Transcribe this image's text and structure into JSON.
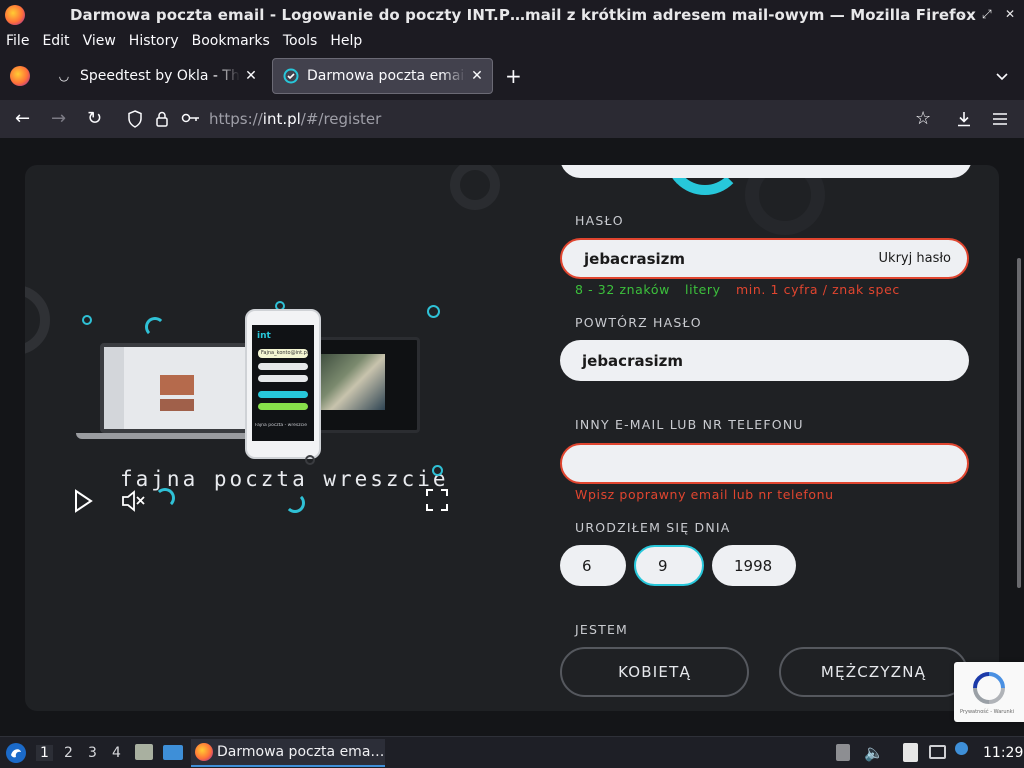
{
  "window": {
    "title": "Darmowa poczta email - Logowanie do poczty INT.P…mail z krótkim adresem mail-owym — Mozilla Firefox",
    "controls": [
      "⌄",
      "⤢",
      "✕"
    ]
  },
  "menu": [
    "File",
    "Edit",
    "View",
    "History",
    "Bookmarks",
    "Tools",
    "Help"
  ],
  "tabs": [
    {
      "label": "Speedtest by Okla - The Global Broadband Speed Test",
      "active": false
    },
    {
      "label": "Darmowa poczta email - Logowanie",
      "active": true
    }
  ],
  "nav": {
    "url_prefix": "https://",
    "url_host": "int.pl",
    "url_path": "/#/register"
  },
  "promo": {
    "tagline": "fajna poczta wreszcie",
    "phone_email": "Fajna_konto@int.pl",
    "phone_footer": "Fajna poczta - wreszcie"
  },
  "form": {
    "password_label": "HASŁO",
    "password_value": "jebacrasizm",
    "toggle_password": "Ukryj hasło",
    "hint_length": "8 - 32 znaków",
    "hint_letters": "litery",
    "hint_digit": "min. 1 cyfra / znak spec",
    "repeat_label": "POWTÓRZ HASŁO",
    "repeat_value": "jebacrasizm",
    "alt_label": "INNY E-MAIL LUB NR TELEFONU",
    "alt_value": "",
    "alt_error": "Wpisz poprawny email lub nr telefonu",
    "birth_label": "URODZIŁEM SIĘ DNIA",
    "birth_day": "6",
    "birth_month": "9",
    "birth_year": "1998",
    "gender_label": "JESTEM",
    "gender_female": "KOBIETĄ",
    "gender_male": "MĘŻCZYZNĄ"
  },
  "recaptcha": {
    "footer": "Prywatność - Warunki"
  },
  "taskbar": {
    "workspaces": [
      "1",
      "2",
      "3",
      "4"
    ],
    "task_label": "Darmowa poczta ema…",
    "clock": "11:29"
  },
  "colors": {
    "accent": "#27c7da",
    "error": "#e0452f",
    "ok": "#3cc03c"
  }
}
